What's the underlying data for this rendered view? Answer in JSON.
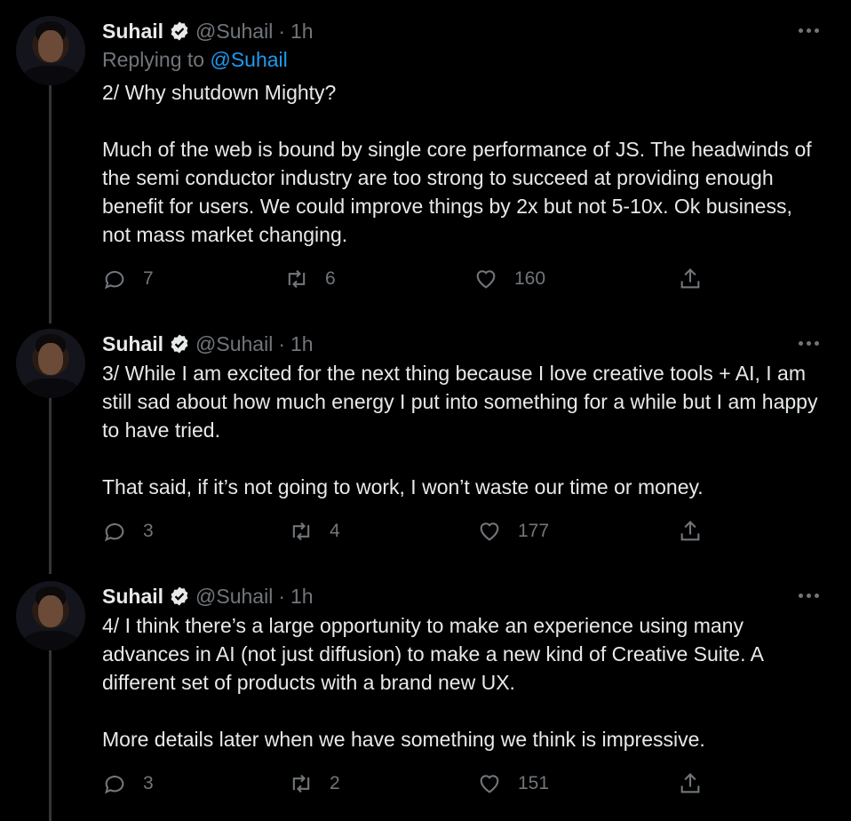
{
  "tweets": [
    {
      "name": "Suhail",
      "handle": "@Suhail",
      "dot": "·",
      "time": "1h",
      "replying_prefix": "Replying to",
      "replying_mention": "@Suhail",
      "text": "2/ Why shutdown Mighty?\n\nMuch of the web is bound by single core performance of JS. The headwinds of the semi conductor industry are too strong to succeed at providing enough benefit for users. We could improve things by 2x but not 5-10x. Ok business, not mass market changing.",
      "replies": "7",
      "retweets": "6",
      "likes": "160"
    },
    {
      "name": "Suhail",
      "handle": "@Suhail",
      "dot": "·",
      "time": "1h",
      "text": "3/ While I am excited for the next thing because I love creative tools + AI, I am still sad about how much energy I put into something for a while but I am happy to have tried.\n\nThat said, if it’s not going to work, I won’t waste our time or money.",
      "replies": "3",
      "retweets": "4",
      "likes": "177"
    },
    {
      "name": "Suhail",
      "handle": "@Suhail",
      "dot": "·",
      "time": "1h",
      "text": "4/ I think there’s a large opportunity to make an experience using many advances in AI (not just diffusion) to make a new kind of Creative Suite. A different set of products with a brand new UX.\n\nMore details later when we have something we think is impressive.",
      "replies": "3",
      "retweets": "2",
      "likes": "151"
    }
  ],
  "icons": {
    "verified": "verified-badge-icon",
    "reply": "reply-icon",
    "retweet": "retweet-icon",
    "like": "heart-icon",
    "share": "share-icon",
    "more": "more-icon"
  },
  "colors": {
    "background": "#000000",
    "text": "#e7e9ea",
    "muted": "#71767b",
    "accent": "#1d9bf0",
    "thread_line": "#333639"
  }
}
